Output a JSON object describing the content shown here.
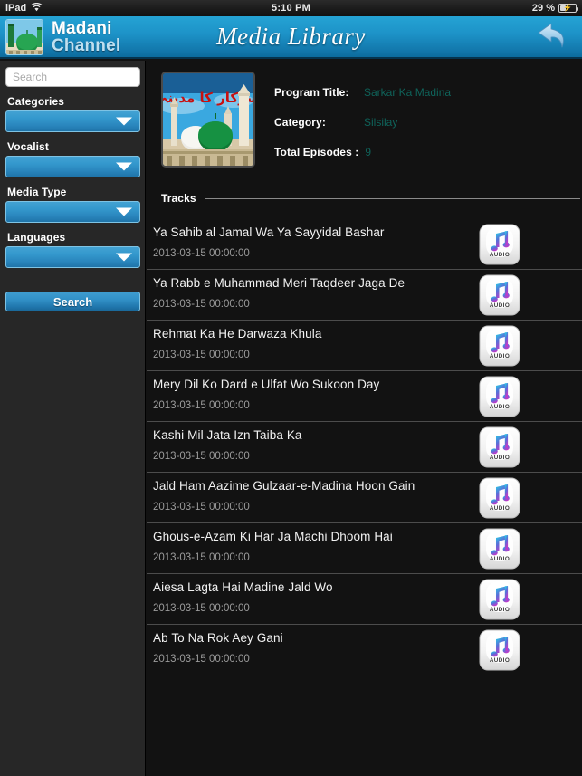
{
  "statusbar": {
    "device": "iPad",
    "wifi_icon": "wifi-icon",
    "time": "5:10 PM",
    "battery_percent": "29 %",
    "battery_icon": "battery-charging-icon"
  },
  "appbar": {
    "logo_icon": "madani-channel-logo-icon",
    "brand_line1": "Madani",
    "brand_line2": "Channel",
    "title": "Media Library",
    "back_icon": "back-arrow-icon",
    "accent_blue": "#1d93c8"
  },
  "sidebar": {
    "search": {
      "placeholder": "Search",
      "value": ""
    },
    "filters": [
      {
        "label": "Categories",
        "value": "",
        "icon": "chevron-down-icon"
      },
      {
        "label": "Vocalist",
        "value": "",
        "icon": "chevron-down-icon"
      },
      {
        "label": "Media Type",
        "value": "",
        "icon": "chevron-down-icon"
      },
      {
        "label": "Languages",
        "value": "",
        "icon": "chevron-down-icon"
      }
    ],
    "search_button": "Search"
  },
  "program": {
    "thumbnail_icon": "program-thumbnail-madina-mosque",
    "fields": [
      {
        "key": "Program Title:",
        "value": "Sarkar Ka Madina"
      },
      {
        "key": "Category:",
        "value": "Silsilay"
      }
    ],
    "episodes_key": "Total Episodes :",
    "episodes_value": "9",
    "value_color": "#0f635a"
  },
  "tracks_section": {
    "header": "Tracks",
    "items": [
      {
        "title": "Ya Sahib al Jamal Wa Ya Sayyidal Bashar",
        "date": "2013-03-15 00:00:00",
        "icon": "audio-file-icon"
      },
      {
        "title": "Ya Rabb e  Muhammad Meri Taqdeer Jaga De",
        "date": "2013-03-15 00:00:00",
        "icon": "audio-file-icon"
      },
      {
        "title": "Rehmat Ka He Darwaza Khula",
        "date": "2013-03-15 00:00:00",
        "icon": "audio-file-icon"
      },
      {
        "title": "Mery Dil Ko Dard e  Ulfat Wo Sukoon Day",
        "date": "2013-03-15 00:00:00",
        "icon": "audio-file-icon"
      },
      {
        "title": "Kashi Mil Jata Izn Taiba Ka",
        "date": "2013-03-15 00:00:00",
        "icon": "audio-file-icon"
      },
      {
        "title": "Jald Ham Aazime Gulzaar-e-Madina Hoon Gain",
        "date": "2013-03-15 00:00:00",
        "icon": "audio-file-icon"
      },
      {
        "title": "Ghous-e-Azam Ki Har Ja Machi Dhoom Hai",
        "date": "2013-03-15 00:00:00",
        "icon": "audio-file-icon"
      },
      {
        "title": "Aiesa Lagta Hai Madine Jald Wo",
        "date": "2013-03-15 00:00:00",
        "icon": "audio-file-icon"
      },
      {
        "title": "Ab To Na Rok Aey Gani",
        "date": "2013-03-15 00:00:00",
        "icon": "audio-file-icon"
      }
    ],
    "audio_badge_text": "AUDIO"
  }
}
